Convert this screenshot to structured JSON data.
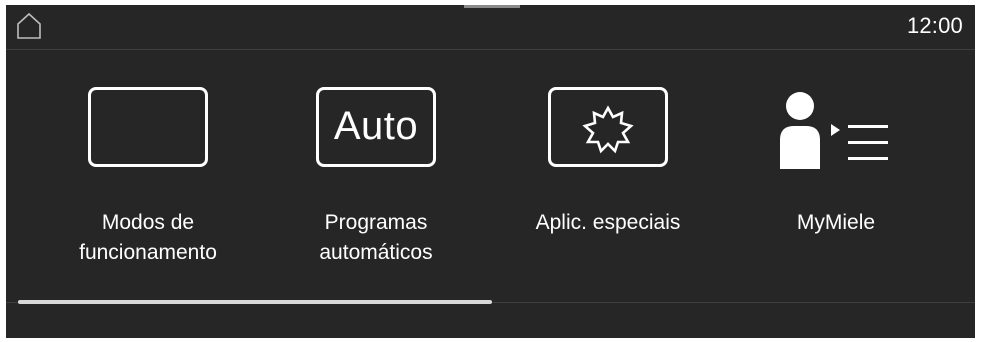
{
  "status_bar": {
    "home_icon": "home-icon",
    "time": "12:00"
  },
  "tiles": [
    {
      "icon": "operating-modes-icon",
      "label_line1": "Modos de",
      "label_line2": "funcionamento"
    },
    {
      "icon": "auto-programs-icon",
      "icon_text": "Auto",
      "label_line1": "Programas",
      "label_line2": "automáticos"
    },
    {
      "icon": "special-applications-icon",
      "label_line1": "Aplic. especiais",
      "label_line2": ""
    },
    {
      "icon": "mymiele-profile-icon",
      "label_line1": "MyMiele",
      "label_line2": ""
    }
  ],
  "scrollbar": {
    "position_fraction": 0.5
  },
  "colors": {
    "background": "#262626",
    "foreground": "#ffffff",
    "divider": "#3f3f3f",
    "scrollbar": "#d8d8d8"
  }
}
